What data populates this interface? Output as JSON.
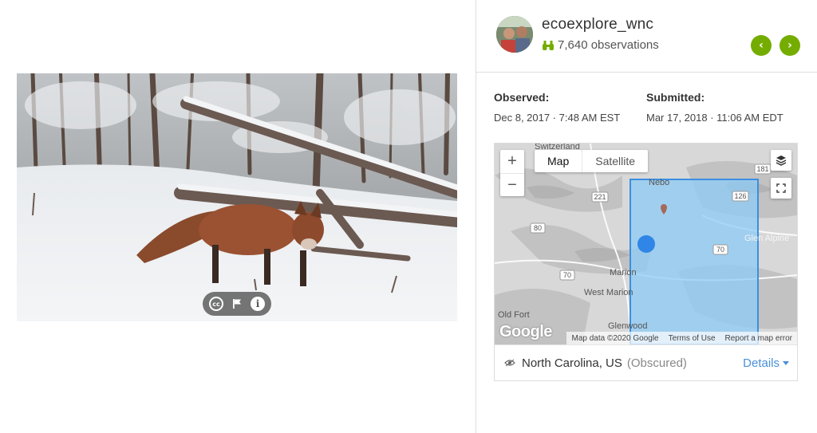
{
  "user": {
    "username": "ecoexplore_wnc",
    "observations": "7,640 observations"
  },
  "nav": {
    "prev_icon": "chevron-left-icon",
    "next_icon": "chevron-right-icon"
  },
  "dates": {
    "observed_label": "Observed:",
    "observed_value": "Dec 8, 2017 · 7:48 AM EST",
    "submitted_label": "Submitted:",
    "submitted_value": "Mar 17, 2018 · 11:06 AM EDT"
  },
  "map": {
    "type_options": [
      "Map",
      "Satellite"
    ],
    "zoom_in": "+",
    "zoom_out": "−",
    "logo": "Google",
    "footer": [
      "Map data ©2020 Google",
      "Terms of Use",
      "Report a map error"
    ],
    "labels": [
      "Switzerland",
      "181",
      "221",
      "126",
      "80",
      "Nebo",
      "70",
      "Glen Alpine",
      "70",
      "Marion",
      "West Marion",
      "Old Fort",
      "Glenwood"
    ],
    "accent": "#74ac00",
    "obscured_fill": "#7ec4f5"
  },
  "place": {
    "name": "North Carolina, US",
    "obscured": "(Obscured)",
    "details": "Details"
  }
}
